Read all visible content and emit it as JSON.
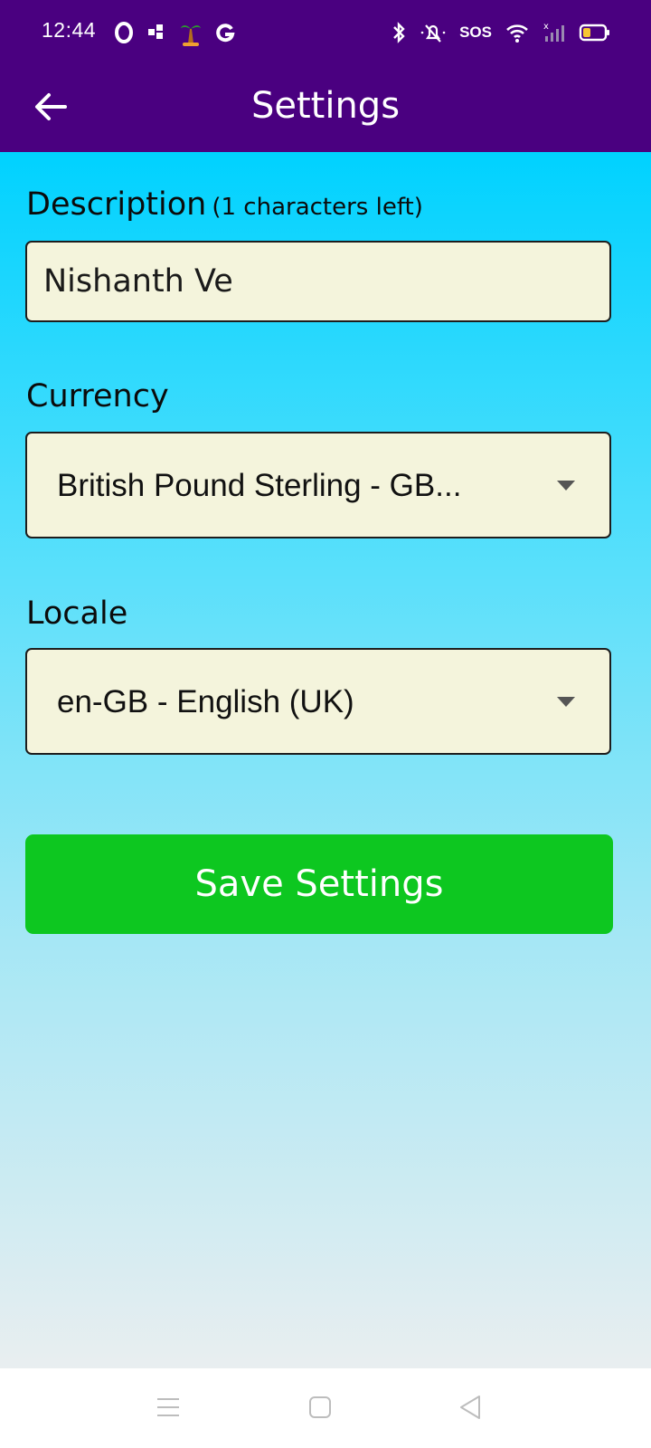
{
  "status_bar": {
    "time": "12:44",
    "sos_label": "SOS",
    "left_icons": [
      "opera-icon",
      "notification-icon",
      "palm-tree-icon",
      "google-icon"
    ],
    "right_icons": [
      "bluetooth-icon",
      "silent-icon",
      "sos",
      "wifi-icon",
      "signal-icon",
      "battery-icon"
    ],
    "color": "#4a0080"
  },
  "app_bar": {
    "title": "Settings",
    "back_icon": "arrow-left-icon"
  },
  "form": {
    "description": {
      "label": "Description",
      "hint": "(1 characters left)",
      "value": "Nishanth Ve"
    },
    "currency": {
      "label": "Currency",
      "selected": "British Pound Sterling - GB..."
    },
    "locale": {
      "label": "Locale",
      "selected": "en-GB - English (UK)"
    },
    "save_label": "Save Settings",
    "save_color": "#0dc720",
    "field_bg": "#f4f4dc"
  },
  "nav_bar": {
    "items": [
      "menu-icon",
      "home-icon",
      "back-icon"
    ]
  }
}
